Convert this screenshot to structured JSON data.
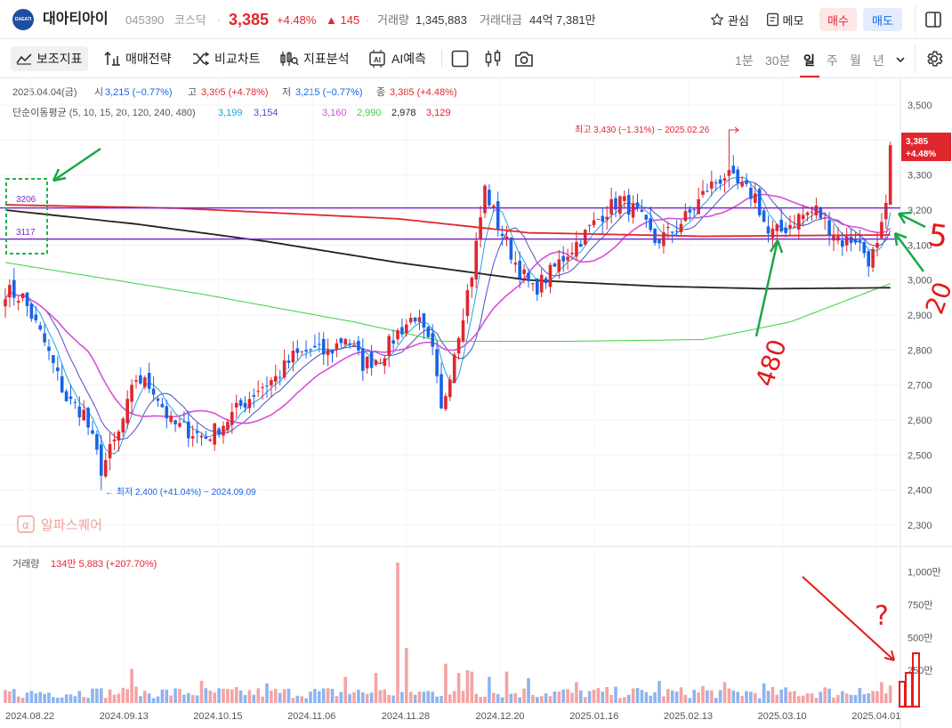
{
  "header": {
    "logo_text": "DAEATI",
    "stock_name": "대아티아이",
    "stock_code": "045390",
    "market": "코스닥",
    "price": "3,385",
    "change_pct": "+4.48%",
    "change_amt": "▲ 145",
    "volume_label": "거래량",
    "volume_value": "1,345,883",
    "amount_label": "거래대금",
    "amount_value": "44억 7,381만",
    "watch_label": "관심",
    "memo_label": "메모",
    "buy_label": "매수",
    "sell_label": "매도"
  },
  "toolbar": {
    "indicator_label": "보조지표",
    "strategy_label": "매매전략",
    "compare_label": "비교차트",
    "analysis_label": "지표분석",
    "ai_label": "AI예측",
    "timeframes": [
      "1분",
      "30분",
      "일",
      "주",
      "월",
      "년"
    ],
    "active_timeframe": "일"
  },
  "ohlc": {
    "date": "2025.04.04(금)",
    "open_label": "시",
    "open": "3,215 (−0.77%)",
    "high_label": "고",
    "high": "3,395 (+4.78%)",
    "low_label": "저",
    "low": "3,215 (−0.77%)",
    "close_label": "종",
    "close": "3,385 (+4.48%)"
  },
  "ma": {
    "label": "단순이동평균 (5, 10, 15, 20, 120, 240, 480)",
    "values": [
      "3,199",
      "3,154",
      "3,160",
      "2,990",
      "2,978",
      "3,129"
    ],
    "colors": [
      "#1fa1e8",
      "#4b4fc2",
      "#d94fd9",
      "#3cd23c",
      "#222222",
      "#e2262e"
    ]
  },
  "annotations": {
    "high": "최고 3,430 (−1.31%) − 2025.02.26",
    "low": "← 최저 2,400 (+41.04%) − 2024.09.09",
    "line_upper": "3206",
    "line_lower": "3117",
    "current_price": "3,385",
    "current_pct": "+4.48%",
    "hand_5": "5",
    "hand_20": "20",
    "hand_480": "480",
    "hand_q": "?",
    "watermark": "알파스퀘어"
  },
  "volume": {
    "label": "거래량",
    "value": "134만 5,883 (+207.70%)"
  },
  "chart_data": {
    "type": "candlestick",
    "price_axis": {
      "min": 2300,
      "max": 3500,
      "ticks": [
        3500,
        3400,
        3300,
        3200,
        3100,
        3000,
        2900,
        2800,
        2700,
        2600,
        2500,
        2400,
        2300
      ],
      "tick_labels": [
        "3,500",
        "3,400",
        "3,300",
        "3,200",
        "3,100",
        "3,000",
        "2,900",
        "2,800",
        "2,700",
        "2,600",
        "2,500",
        "2,400",
        "2,300"
      ]
    },
    "volume_axis": {
      "min": 0,
      "max": 1000,
      "ticks": [
        1000,
        750,
        500,
        250
      ],
      "tick_labels": [
        "1,000만",
        "750만",
        "500만",
        "250만"
      ]
    },
    "x_labels": [
      "2024.08.22",
      "2024.09.13",
      "2024.10.15",
      "2024.11.06",
      "2024.11.28",
      "2024.12.20",
      "2025.01.16",
      "2025.02.13",
      "2025.03.10",
      "2025.04.01"
    ],
    "close_anchors": [
      [
        0,
        2970
      ],
      [
        4,
        2950
      ],
      [
        9,
        2820
      ],
      [
        14,
        2660
      ],
      [
        18,
        2620
      ],
      [
        22,
        2460
      ],
      [
        26,
        2560
      ],
      [
        30,
        2720
      ],
      [
        34,
        2690
      ],
      [
        38,
        2590
      ],
      [
        42,
        2570
      ],
      [
        46,
        2550
      ],
      [
        50,
        2590
      ],
      [
        54,
        2640
      ],
      [
        58,
        2690
      ],
      [
        62,
        2720
      ],
      [
        66,
        2780
      ],
      [
        70,
        2800
      ],
      [
        74,
        2790
      ],
      [
        78,
        2840
      ],
      [
        82,
        2760
      ],
      [
        86,
        2780
      ],
      [
        90,
        2850
      ],
      [
        94,
        2900
      ],
      [
        98,
        2790
      ],
      [
        100,
        2620
      ],
      [
        103,
        2800
      ],
      [
        107,
        3020
      ],
      [
        110,
        3260
      ],
      [
        113,
        3160
      ],
      [
        117,
        3050
      ],
      [
        121,
        2970
      ],
      [
        125,
        3020
      ],
      [
        129,
        3080
      ],
      [
        133,
        3130
      ],
      [
        137,
        3190
      ],
      [
        141,
        3230
      ],
      [
        145,
        3190
      ],
      [
        149,
        3110
      ],
      [
        153,
        3140
      ],
      [
        157,
        3190
      ],
      [
        161,
        3260
      ],
      [
        165,
        3300
      ],
      [
        169,
        3260
      ],
      [
        172,
        3240
      ],
      [
        175,
        3130
      ],
      [
        178,
        3140
      ],
      [
        182,
        3180
      ],
      [
        186,
        3200
      ],
      [
        189,
        3150
      ],
      [
        192,
        3110
      ],
      [
        195,
        3120
      ],
      [
        198,
        3060
      ],
      [
        200,
        3090
      ],
      [
        202,
        3200
      ],
      [
        203,
        3385
      ]
    ],
    "last_candle": {
      "open": 3215,
      "high": 3395,
      "low": 3215,
      "close": 3385
    },
    "high_point": {
      "index": 166,
      "value": 3430
    },
    "low_point": {
      "index": 22,
      "value": 2400
    },
    "horizontal_lines": [
      3206,
      3117
    ],
    "ma_series": [
      {
        "period": 5,
        "color": "#1fa1e8",
        "last": 3199
      },
      {
        "period": 10,
        "color": "#4b4fc2",
        "last": 3154
      },
      {
        "period": 20,
        "color": "#d94fd9",
        "last": 3160
      },
      {
        "period": 120,
        "color": "#3cd23c",
        "last": 2990
      },
      {
        "period": 240,
        "color": "#222222",
        "last": 2978
      },
      {
        "period": 480,
        "color": "#e2262e",
        "last": 3129
      }
    ],
    "volume_spikes": [
      {
        "index": 90,
        "value": 1070
      },
      {
        "index": 104,
        "value": 230
      },
      {
        "index": 107,
        "value": 240
      },
      {
        "index": 203,
        "value": 134
      }
    ]
  }
}
